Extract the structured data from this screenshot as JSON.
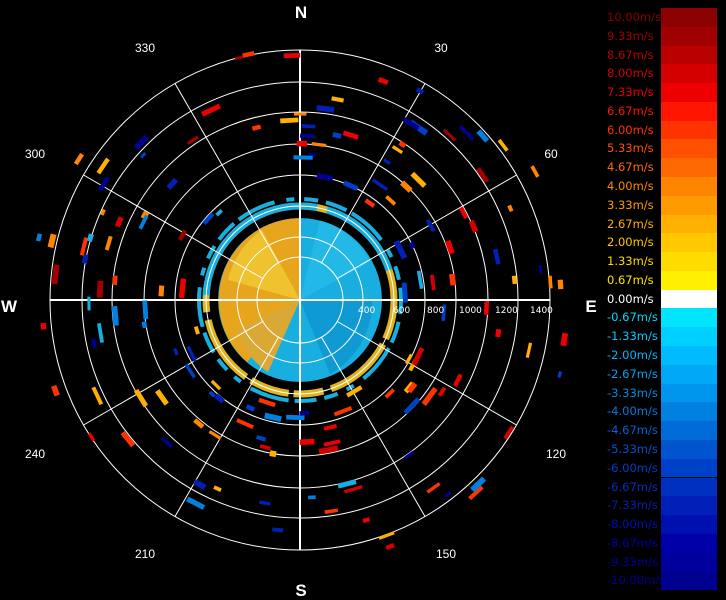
{
  "compass": {
    "north": "N",
    "east": "E",
    "south": "S",
    "west": "W"
  },
  "angle_labels": [
    "30",
    "60",
    "120",
    "150",
    "210",
    "240",
    "300",
    "330"
  ],
  "range_labels": [
    "400",
    "600",
    "800",
    "1000",
    "1200",
    "1400"
  ],
  "legend": [
    {
      "label": "10.00m/s",
      "color": "#8b0000",
      "text": "#8b0000"
    },
    {
      "label": "9.33m/s",
      "color": "#a00000",
      "text": "#a00000"
    },
    {
      "label": "8.67m/s",
      "color": "#bb0000",
      "text": "#bb0000"
    },
    {
      "label": "8.00m/s",
      "color": "#d40000",
      "text": "#d40000"
    },
    {
      "label": "7.33m/s",
      "color": "#ee0000",
      "text": "#ee0000"
    },
    {
      "label": "6.67m/s",
      "color": "#ff1500",
      "text": "#ff1500"
    },
    {
      "label": "6.00m/s",
      "color": "#ff3300",
      "text": "#ff3300"
    },
    {
      "label": "5.33m/s",
      "color": "#ff5000",
      "text": "#ff5000"
    },
    {
      "label": "4.67m/s",
      "color": "#ff6a00",
      "text": "#ff6a00"
    },
    {
      "label": "4.00m/s",
      "color": "#ff8500",
      "text": "#ff8500"
    },
    {
      "label": "3.33m/s",
      "color": "#ff9a00",
      "text": "#ff9a00"
    },
    {
      "label": "2.67m/s",
      "color": "#ffb000",
      "text": "#ffb000"
    },
    {
      "label": "2.00m/s",
      "color": "#ffc800",
      "text": "#ffc800"
    },
    {
      "label": "1.33m/s",
      "color": "#ffdc00",
      "text": "#ffdc00"
    },
    {
      "label": "0.67m/s",
      "color": "#fff000",
      "text": "#ffe600"
    },
    {
      "label": "0.00m/s",
      "color": "#ffffff",
      "text": "#ffffff"
    },
    {
      "label": "-0.67m/s",
      "color": "#00e5ff",
      "text": "#00d8ff"
    },
    {
      "label": "-1.33m/s",
      "color": "#00d0ff",
      "text": "#00c8ff"
    },
    {
      "label": "-2.00m/s",
      "color": "#00bbff",
      "text": "#00b4ff"
    },
    {
      "label": "-2.67m/s",
      "color": "#00a8f5",
      "text": "#00a0f0"
    },
    {
      "label": "-3.33m/s",
      "color": "#0095ec",
      "text": "#008ce6"
    },
    {
      "label": "-4.00m/s",
      "color": "#0080e0",
      "text": "#0078e0"
    },
    {
      "label": "-4.67m/s",
      "color": "#006ad8",
      "text": "#0064d8"
    },
    {
      "label": "-5.33m/s",
      "color": "#0055cf",
      "text": "#0050d0"
    },
    {
      "label": "-6.00m/s",
      "color": "#0040c8",
      "text": "#003cc8"
    },
    {
      "label": "-6.67m/s",
      "color": "#0030c0",
      "text": "#0030c0"
    },
    {
      "label": "-7.33m/s",
      "color": "#0020b8",
      "text": "#0020b8"
    },
    {
      "label": "-8.00m/s",
      "color": "#0010b0",
      "text": "#0010b0"
    },
    {
      "label": "-8.67m/s",
      "color": "#0000a8",
      "text": "#0000a8"
    },
    {
      "label": "-9.33m/s",
      "color": "#00009c",
      "text": "#000098"
    },
    {
      "label": "-10.00m/s",
      "color": "#000090",
      "text": "#00008c"
    }
  ],
  "colors": {
    "background": "#000000",
    "grid": "#ffffff",
    "approach": "#e8a818",
    "recede": "#19aee0"
  }
}
